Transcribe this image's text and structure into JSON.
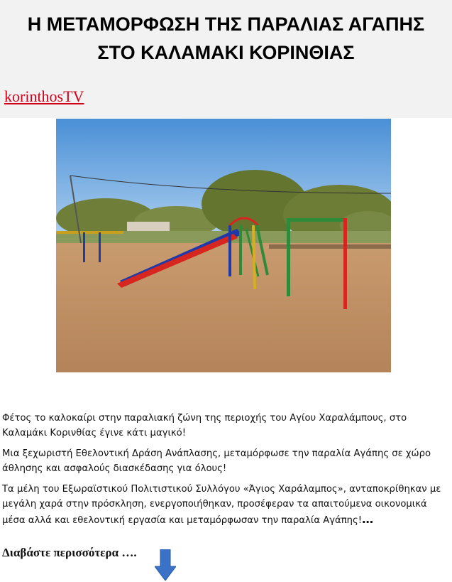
{
  "article": {
    "title_line1": "Η ΜΕΤΑΜΟΡΦΩΣΗ ΤΗΣ ΠΑΡΑΛΙΑΣ ΑΓΑΠΗΣ",
    "title_line2": "ΣΤΟ ΚΑΛΑΜΑΚΙ ΚΟΡΙΝΘΙΑΣ",
    "source": "korinthosTV",
    "paragraphs": [
      "Φέτος το καλοκαίρι στην παραλιακή ζώνη της περιοχής του Αγίου Χαραλάμπους, στο Καλαμάκι Κορινθίας έγινε κάτι μαγικό!",
      "Μια ξεχωριστή Εθελοντική Δράση Ανάπλασης, μεταμόρφωσε την παραλία Αγάπης σε χώρο άθλησης και ασφαλούς διασκέδασης για όλους!",
      "Τα μέλη του  Εξωραϊστικού Πολιτιστικού Συλλόγου «Άγιος Χαράλαμπος», ανταποκρίθηκαν με μεγάλη χαρά στην πρόσκληση, ενεργοποιήθηκαν, προσέφεραν τα απαιτούμενα οικονομικά μέσα αλλά και  εθελοντική εργασία και μεταμόρφωσαν την παραλία Αγάπης!"
    ],
    "ellipsis": "…",
    "read_more": "Διαβάστε περισσότερα ….",
    "icons": {
      "photo": "playground-photo",
      "arrow": "down-arrow-icon"
    },
    "colors": {
      "link": "#d0021b",
      "arrow": "#3a72c8",
      "header_bg": "#f2f2f2"
    }
  }
}
